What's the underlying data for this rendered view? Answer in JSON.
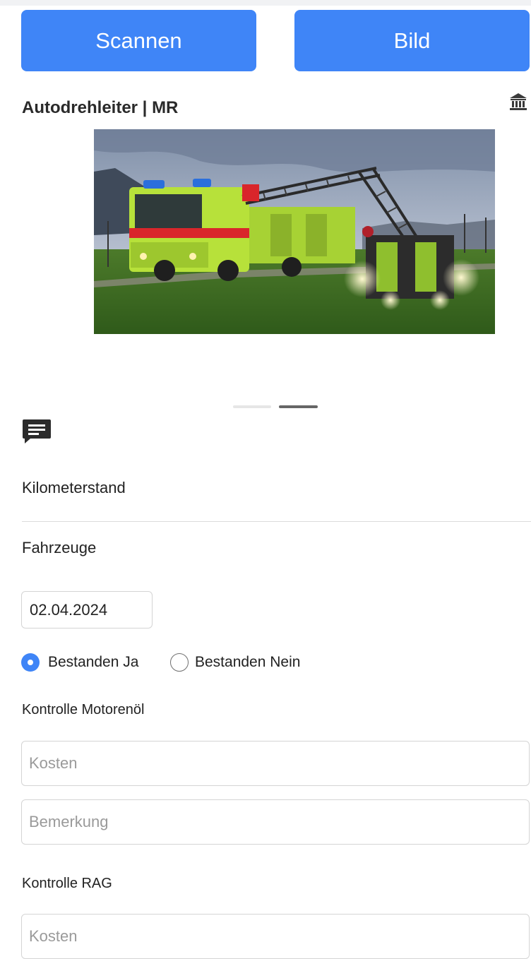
{
  "header": {
    "scan_label": "Scannen",
    "image_label": "Bild"
  },
  "vehicle": {
    "title": "Autodrehleiter | MR"
  },
  "carousel": {
    "slide_count": 2,
    "active_index": 1
  },
  "form": {
    "mileage_label": "Kilometerstand",
    "vehicles_label": "Fahrzeuge",
    "date_value": "02.04.2024",
    "passed_yes_label": "Bestanden Ja",
    "passed_no_label": "Bestanden Nein",
    "passed_selected": "yes",
    "checks": [
      {
        "title": "Kontrolle Motorenöl",
        "cost_placeholder": "Kosten",
        "remark_placeholder": "Bemerkung"
      },
      {
        "title": "Kontrolle RAG",
        "cost_placeholder": "Kosten"
      }
    ]
  },
  "icons": {
    "bank": "bank-icon",
    "comment": "comment-icon"
  },
  "colors": {
    "accent": "#3f85f7",
    "truck_body": "#b7e13a",
    "truck_stripe": "#d9262b"
  }
}
